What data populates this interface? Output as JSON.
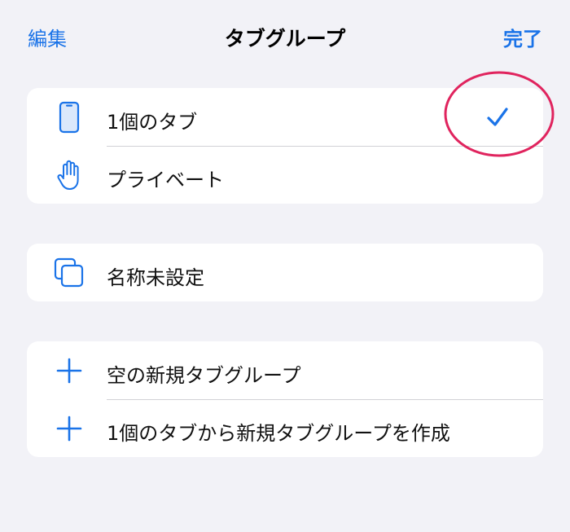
{
  "nav": {
    "edit_label": "編集",
    "title": "タブグループ",
    "done_label": "完了"
  },
  "groups": {
    "current": [
      {
        "label": "1個のタブ",
        "icon": "iphone-icon",
        "selected": true
      },
      {
        "label": "プライベート",
        "icon": "hand-raised-icon",
        "selected": false
      }
    ],
    "saved": [
      {
        "label": "名称未設定",
        "icon": "square-on-square-icon"
      }
    ],
    "actions": [
      {
        "label": "空の新規タブグループ",
        "icon": "plus-icon"
      },
      {
        "label": "1個のタブから新規タブグループを作成",
        "icon": "plus-icon"
      }
    ]
  },
  "colors": {
    "accent": "#1a73e8",
    "background": "#f2f2f7",
    "card": "#ffffff",
    "annotation": "#e0245e"
  }
}
